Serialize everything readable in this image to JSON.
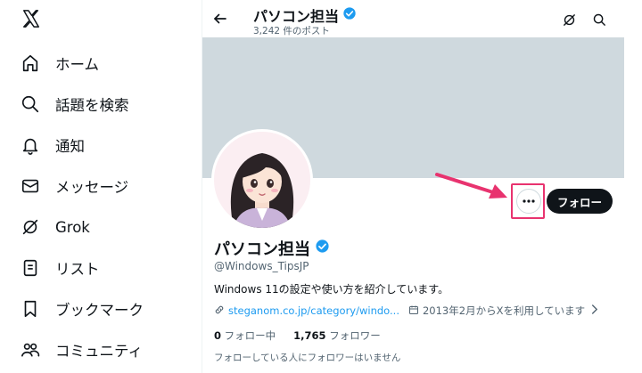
{
  "sidebar": {
    "items": [
      {
        "label": "ホーム",
        "icon": "home-icon"
      },
      {
        "label": "話題を検索",
        "icon": "search-icon"
      },
      {
        "label": "通知",
        "icon": "bell-icon"
      },
      {
        "label": "メッセージ",
        "icon": "mail-icon"
      },
      {
        "label": "Grok",
        "icon": "grok-icon"
      },
      {
        "label": "リスト",
        "icon": "list-icon"
      },
      {
        "label": "ブックマーク",
        "icon": "bookmark-icon"
      },
      {
        "label": "コミュニティ",
        "icon": "community-icon"
      }
    ]
  },
  "header": {
    "name": "パソコン担当",
    "posts": "3,242 件のポスト"
  },
  "profile": {
    "name": "パソコン担当",
    "handle": "@Windows_TipsJP",
    "bio": "Windows 11の設定や使い方を紹介しています。",
    "link": "steganom.co.jp/category/windo...",
    "joined": "2013年2月からXを利用しています",
    "following_count": "0",
    "following_label": "フォロー中",
    "followers_count": "1,765",
    "followers_label": "フォロワー",
    "followers_note": "フォローしている人にフォロワーはいません",
    "follow_button": "フォロー",
    "more_button": "···"
  },
  "colors": {
    "verified": "#1d9bf0",
    "banner": "#cfd9de",
    "highlight": "#e8336f",
    "link": "#1d9bf0"
  }
}
